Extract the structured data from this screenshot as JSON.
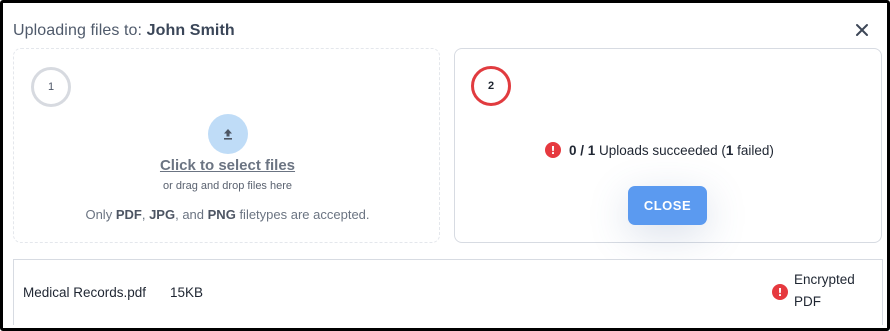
{
  "header": {
    "title_prefix": "Uploading files to:",
    "recipient": "John Smith",
    "close_icon": "close-icon"
  },
  "step1": {
    "number": "1",
    "upload_icon": "upload-arrow-icon",
    "select_link": "Click to select files",
    "drag_text": "or drag and drop files here",
    "accepted_prefix": "Only",
    "type_pdf": "PDF",
    "sep1": ",",
    "type_jpg": "JPG",
    "sep2": ", and",
    "type_png": "PNG",
    "accepted_suffix": "filetypes are accepted."
  },
  "step2": {
    "number": "2",
    "status_icon": "error-icon",
    "succeeded": "0 / 1",
    "succeeded_text": "Uploads succeeded (",
    "failed_count": "1",
    "failed_text": "failed)",
    "close_label": "CLOSE"
  },
  "files": [
    {
      "name": "Medical Records.pdf",
      "size": "15KB",
      "status_icon": "error-icon",
      "status": "Encrypted PDF"
    }
  ],
  "colors": {
    "error": "#e6393f",
    "primary_button": "#5b9af0",
    "upload_icon_bg": "#bfdcf7"
  }
}
